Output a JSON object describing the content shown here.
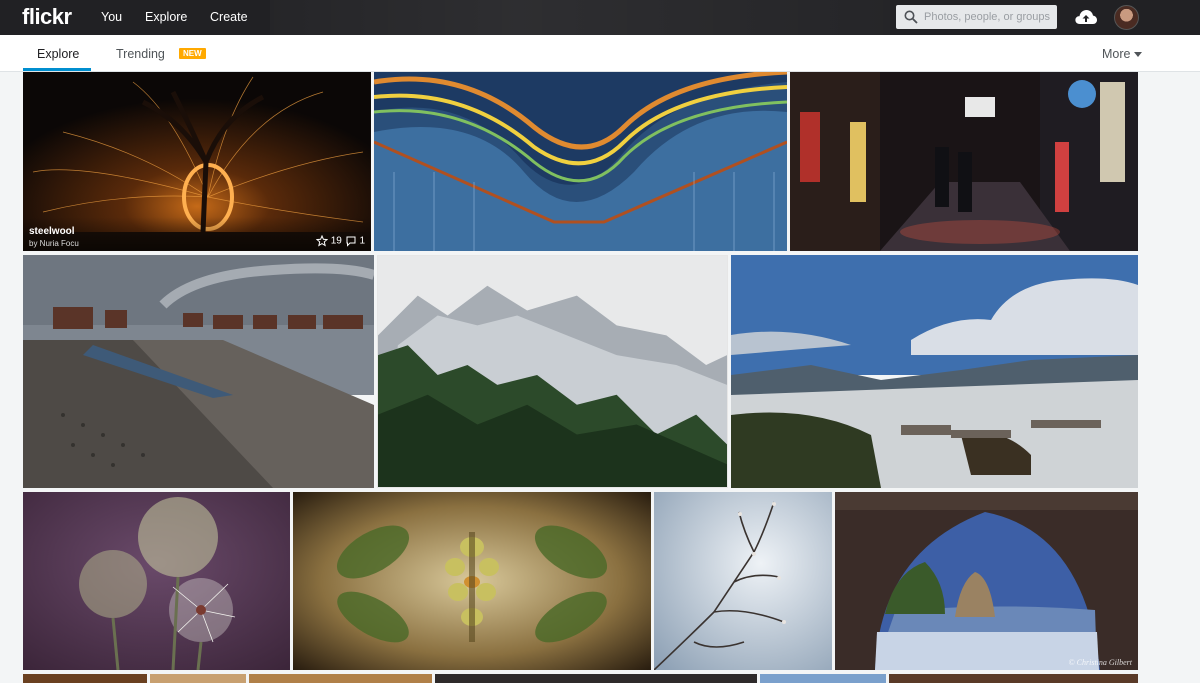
{
  "brand": {
    "logo": "flickr"
  },
  "header": {
    "nav": [
      {
        "label": "You"
      },
      {
        "label": "Explore"
      },
      {
        "label": "Create"
      }
    ],
    "search_placeholder": "Photos, people, or groups",
    "icons": {
      "search": "search-icon",
      "upload": "cloud-upload-icon",
      "avatar": "user-avatar"
    }
  },
  "subnav": {
    "tabs": [
      {
        "label": "Explore",
        "active": true
      },
      {
        "label": "Trending",
        "active": false
      }
    ],
    "badge": "NEW",
    "more": "More"
  },
  "photos": [
    {
      "title": "steelwool",
      "author": "by Nuria Focu",
      "favorites": "19",
      "comments": "1",
      "subject": "steel wool spinning under a tree at night"
    },
    {
      "subject": "curved glass skyscraper bridge"
    },
    {
      "subject": "rainy night street with neon signs"
    },
    {
      "subject": "wooden pier with lake huts"
    },
    {
      "subject": "misty mountain peaks above forest"
    },
    {
      "subject": "snowy valley with village"
    },
    {
      "subject": "dandelion seed heads"
    },
    {
      "subject": "symmetrical flower kaleidoscope"
    },
    {
      "subject": "bare branch against sky"
    },
    {
      "subject": "sea cave arch with rock formation",
      "credit": "© Christina Gilbert"
    }
  ],
  "colors": {
    "topbar": "#212124",
    "accent": "#008ecf",
    "badge": "#ffa900"
  }
}
